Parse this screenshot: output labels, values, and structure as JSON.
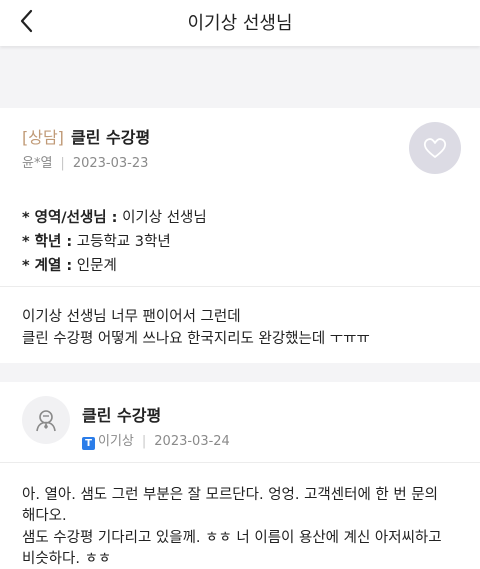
{
  "header": {
    "title": "이기상 선생님",
    "back_icon": "chevron-left-icon"
  },
  "question": {
    "tag": "[상담]",
    "title": "클린 수강평",
    "author": "윤*열",
    "date": "2023-03-23",
    "like_icon": "heart-icon",
    "info": [
      {
        "label": "* 영역/선생님 :",
        "value": " 이기상 선생님"
      },
      {
        "label": "* 학년 :",
        "value": " 고등학교 3학년"
      },
      {
        "label": "* 계열 :",
        "value": " 인문계"
      }
    ],
    "body": [
      "이기상 선생님 너무 팬이어서 그런데",
      "클린 수강평 어떻게 쓰나요 한국지리도 완강했는데 ㅜㅠㅠ"
    ]
  },
  "answer": {
    "title": "클린 수강평",
    "badge": "T",
    "author": "이기상",
    "date": "2023-03-24",
    "avatar_icon": "teacher-avatar-icon",
    "body": [
      "아. 열아. 샘도 그런 부분은 잘 모르단다. 엉엉. 고객센터에 한 번 문의",
      "해다오.",
      "샘도 수강평 기다리고 있을께. ㅎㅎ 너 이름이 용산에 계신 아저씨하고",
      "비슷하다. ㅎㅎ"
    ]
  }
}
